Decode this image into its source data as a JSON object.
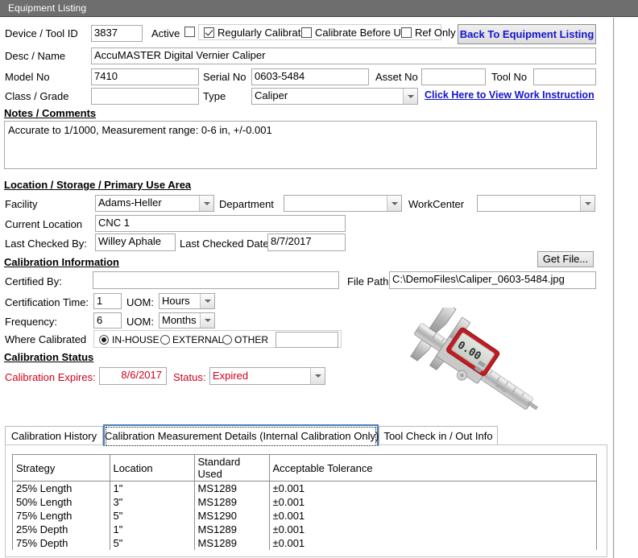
{
  "window": {
    "title": "Equipment Listing"
  },
  "identity": {
    "device_id_label": "Device / Tool ID",
    "device_id_value": "3837",
    "active_label": "Active",
    "active_checked": false,
    "regularly_calibrated_label": "Regularly Calibrated",
    "regularly_calibrated_checked": true,
    "calibrate_before_use_label": "Calibrate Before Use",
    "calibrate_before_use_checked": false,
    "ref_only_label": "Ref Only",
    "ref_only_checked": false,
    "back_button_label": "Back To Equipment Listing",
    "desc_label": "Desc / Name",
    "desc_value": "AccuMASTER Digital Vernier Caliper",
    "model_label": "Model No",
    "model_value": "7410",
    "serial_label": "Serial No",
    "serial_value": "0603-5484",
    "asset_label": "Asset No",
    "asset_value": "",
    "tool_label": "Tool No",
    "tool_value": "",
    "class_label": "Class / Grade",
    "class_value": "",
    "type_label": "Type",
    "type_value": "Caliper",
    "work_instruction_link": "Click Here to View Work Instruction"
  },
  "notes": {
    "heading": "Notes / Comments",
    "value": "Accurate to 1/1000, Measurement range: 0-6 in, +/-0.001"
  },
  "location": {
    "heading": "Location / Storage / Primary Use Area",
    "facility_label": "Facility",
    "facility_value": "Adams-Heller",
    "department_label": "Department",
    "department_value": "",
    "workcenter_label": "WorkCenter",
    "workcenter_value": "",
    "current_location_label": "Current Location",
    "current_location_value": "CNC 1",
    "last_checked_by_label": "Last Checked By:",
    "last_checked_by_value": "Willey Aphale",
    "last_checked_date_label": "Last Checked Date:",
    "last_checked_date_value": "8/7/2017"
  },
  "calibration_info": {
    "heading": "Calibration Information",
    "get_file_label": "Get File...",
    "certified_by_label": "Certified By:",
    "certified_by_value": "",
    "file_path_label": "File Path",
    "file_path_value": "C:\\DemoFiles\\Caliper_0603-5484.jpg",
    "certification_time_label": "Certification Time:",
    "certification_time_value": "1",
    "certification_time_uom_label": "UOM:",
    "certification_time_uom_value": "Hours",
    "frequency_label": "Frequency:",
    "frequency_value": "6",
    "frequency_uom_label": "UOM:",
    "frequency_uom_value": "Months",
    "where_calibrated_label": "Where Calibrated",
    "in_house_label": "IN-HOUSE",
    "external_label": "EXTERNAL",
    "other_label": "OTHER",
    "where_calibrated_selected": "IN-HOUSE",
    "other_value": ""
  },
  "calibration_status": {
    "heading": "Calibration Status",
    "expires_label": "Calibration Expires:",
    "expires_value": "8/6/2017",
    "status_label": "Status:",
    "status_value": "Expired",
    "status_color": "#d0021b"
  },
  "tabs": [
    {
      "label": "Calibration History",
      "active": false
    },
    {
      "label": "Calibration Measurement Details (Internal Calibration Only)",
      "active": true
    },
    {
      "label": "Tool Check in / Out Info",
      "active": false
    }
  ],
  "measurement_table": {
    "columns": [
      "Strategy",
      "Location",
      "Standard Used",
      "Acceptable Tolerance"
    ],
    "rows": [
      [
        "25% Length",
        "1\"",
        "MS1289",
        "±0.001"
      ],
      [
        "50% Length",
        "3\"",
        "MS1289",
        "±0.001"
      ],
      [
        "75% Length",
        "5\"",
        "MS1290",
        "±0.001"
      ],
      [
        "25% Depth",
        "1\"",
        "MS1289",
        "±0.001"
      ],
      [
        "75% Depth",
        "5\"",
        "MS1289",
        "±0.001"
      ]
    ]
  },
  "photo": {
    "alt": "digital-vernier-caliper-photo"
  }
}
